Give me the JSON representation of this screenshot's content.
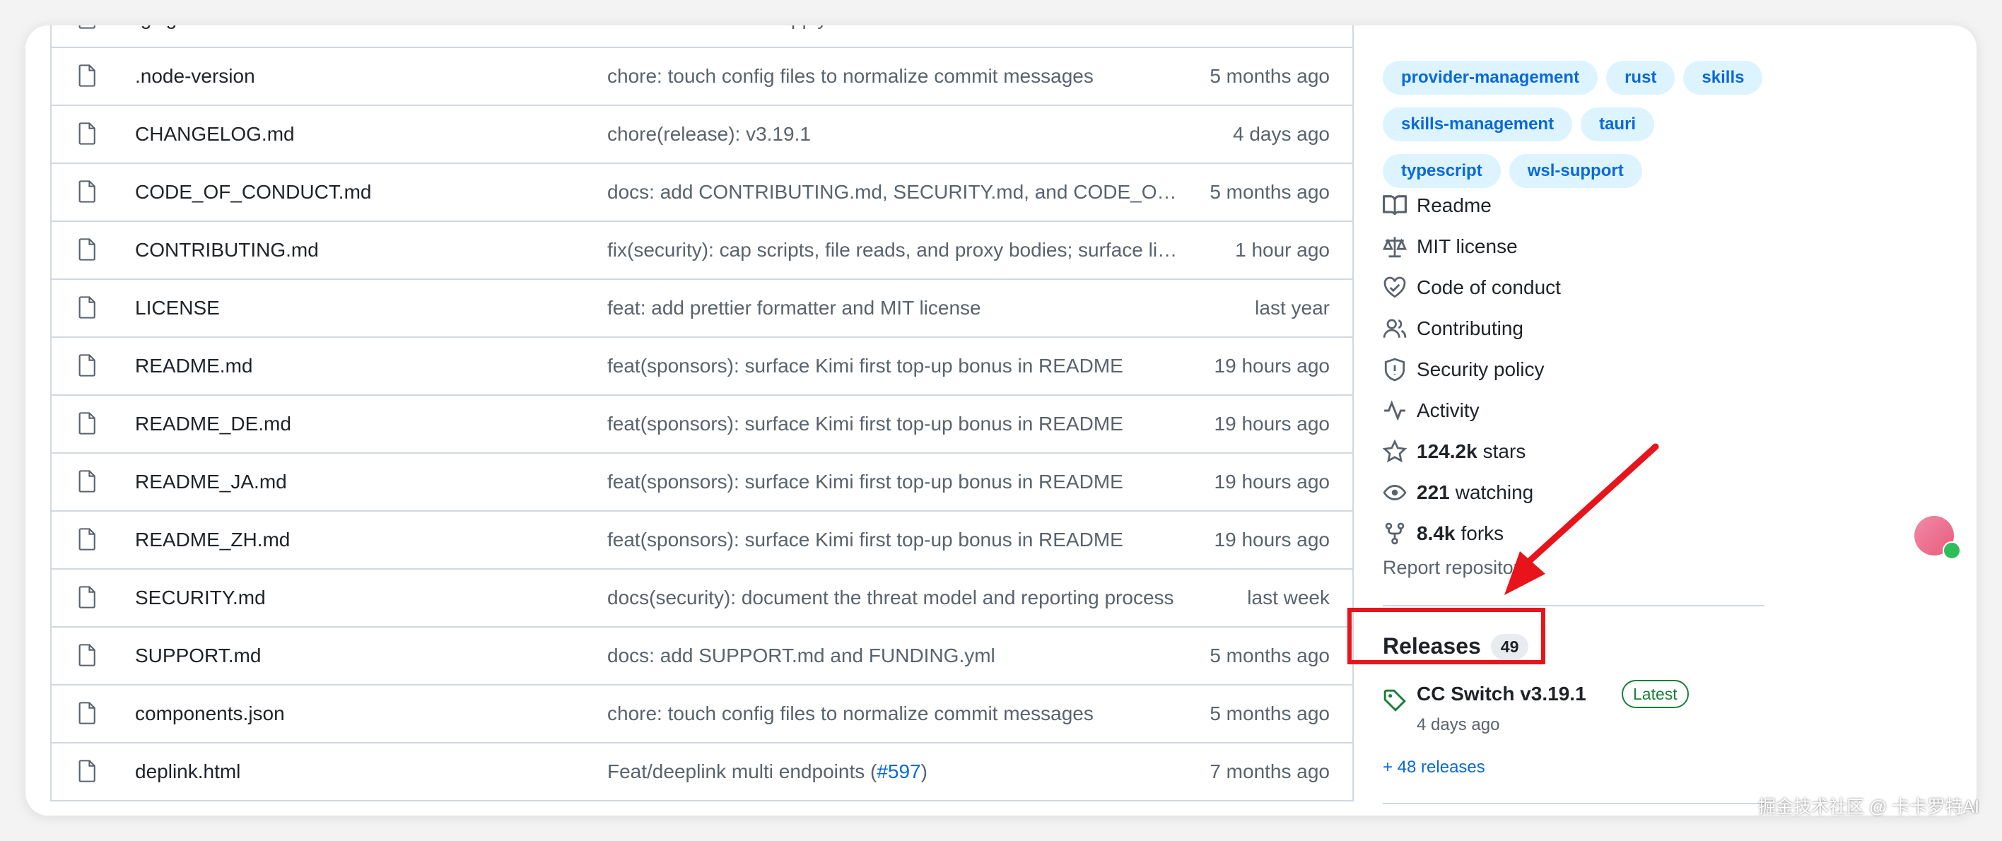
{
  "files": [
    {
      "name": ".gitignore",
      "commit": "ci: harden release supply chain",
      "age": "last month"
    },
    {
      "name": ".node-version",
      "commit": "chore: touch config files to normalize commit messages",
      "age": "5 months ago"
    },
    {
      "name": "CHANGELOG.md",
      "commit": "chore(release): v3.19.1",
      "age": "4 days ago"
    },
    {
      "name": "CODE_OF_CONDUCT.md",
      "commit": "docs: add CONTRIBUTING.md, SECURITY.md, and CODE_OF_CONDUCT.md",
      "age": "5 months ago"
    },
    {
      "name": "CONTRIBUTING.md",
      "commit": "fix(security): cap scripts, file reads, and proxy bodies; surface limits",
      "age": "1 hour ago"
    },
    {
      "name": "LICENSE",
      "commit": "feat: add prettier formatter and MIT license",
      "age": "last year"
    },
    {
      "name": "README.md",
      "commit": "feat(sponsors): surface Kimi first top-up bonus in README",
      "age": "19 hours ago"
    },
    {
      "name": "README_DE.md",
      "commit": "feat(sponsors): surface Kimi first top-up bonus in README",
      "age": "19 hours ago"
    },
    {
      "name": "README_JA.md",
      "commit": "feat(sponsors): surface Kimi first top-up bonus in README",
      "age": "19 hours ago"
    },
    {
      "name": "README_ZH.md",
      "commit": "feat(sponsors): surface Kimi first top-up bonus in README",
      "age": "19 hours ago"
    },
    {
      "name": "SECURITY.md",
      "commit": "docs(security): document the threat model and reporting process",
      "age": "last week"
    },
    {
      "name": "SUPPORT.md",
      "commit": "docs: add SUPPORT.md and FUNDING.yml",
      "age": "5 months ago"
    },
    {
      "name": "components.json",
      "commit": "chore: touch config files to normalize commit messages",
      "age": "5 months ago"
    },
    {
      "name": "deplink.html",
      "commit": "Feat/deeplink multi endpoints (",
      "commit_link": "#597",
      "commit_suffix": ")",
      "age": "7 months ago"
    }
  ],
  "topics": {
    "row0": [
      "provider-management",
      "rust",
      "skills"
    ],
    "row1": [
      "skills-management",
      "tauri"
    ],
    "row2": [
      "typescript",
      "wsl-support"
    ]
  },
  "about": {
    "readme": "Readme",
    "license": "MIT license",
    "conduct": "Code of conduct",
    "contributing": "Contributing",
    "security": "Security policy",
    "activity": "Activity",
    "stars_count": "124.2k",
    "stars_label": "stars",
    "watching_count": "221",
    "watching_label": "watching",
    "forks_count": "8.4k",
    "forks_label": "forks",
    "report": "Report repository"
  },
  "releases": {
    "title": "Releases",
    "count": "49",
    "latest_name": "CC Switch v3.19.1",
    "latest_badge": "Latest",
    "latest_date": "4 days ago",
    "more_link": "+ 48 releases"
  },
  "watermark": "掘金技术社区 @ 卡卡罗特AI",
  "colors": {
    "link": "#0969da",
    "topic_bg": "#ddf4ff",
    "latest_green": "#1a7f37",
    "annotation_red": "#e8141b",
    "border": "#d1d9e0"
  }
}
